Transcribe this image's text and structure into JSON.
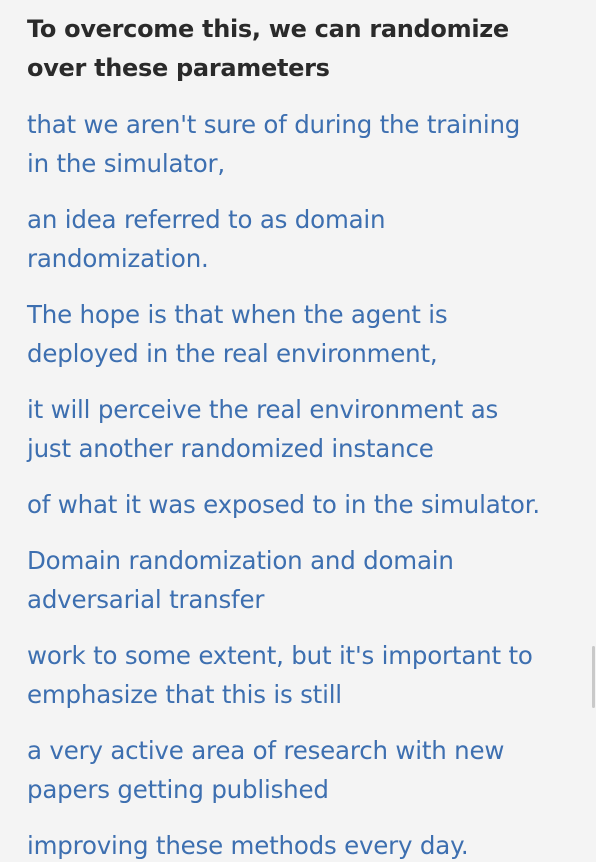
{
  "transcript": {
    "heading_lines": [
      "To overcome this, we can randomize",
      "over these parameters"
    ],
    "segments": [
      [
        "that we aren't sure of during the training",
        "in the simulator,"
      ],
      [
        "an idea referred to as domain",
        "randomization."
      ],
      [
        "The hope is that when the agent is",
        "deployed in the real environment,"
      ],
      [
        "it will perceive the real environment as",
        "just another randomized instance"
      ],
      [
        "of what it was exposed to in the simulator."
      ],
      [
        "Domain randomization and domain",
        "adversarial transfer"
      ],
      [
        "work to some extent, but it's important to",
        "emphasize that this is still"
      ],
      [
        "a very active area of research with new",
        "papers getting published"
      ],
      [
        "improving these methods every day."
      ]
    ]
  },
  "colors": {
    "background": "#f4f4f4",
    "heading_text": "#2a2a2a",
    "segment_text": "#3d6fb0"
  }
}
